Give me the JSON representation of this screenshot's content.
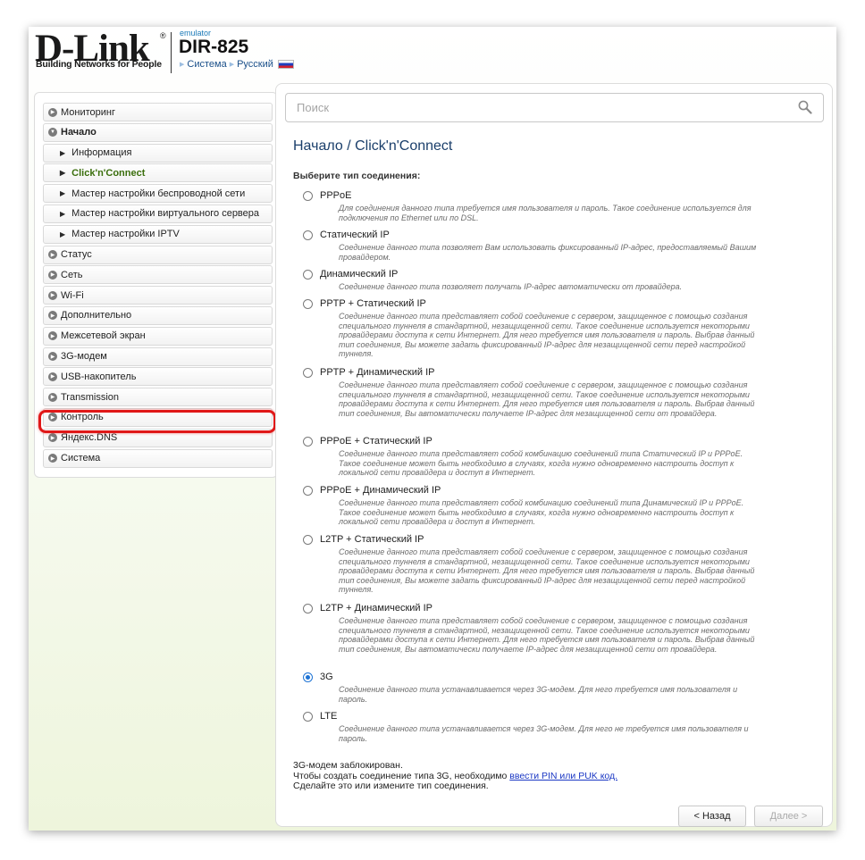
{
  "header": {
    "logo_text": "D-Link",
    "logo_registered": "®",
    "logo_tagline": "Building Networks for People",
    "emulator_label": "emulator",
    "model": "DIR-825",
    "breadcrumb": {
      "system": "Система",
      "language": "Русский"
    }
  },
  "sidebar": {
    "items": [
      {
        "label": "Мониторинг"
      },
      {
        "label": "Начало"
      },
      {
        "label": "Информация"
      },
      {
        "label": "Click'n'Connect"
      },
      {
        "label": "Мастер настройки беспроводной сети"
      },
      {
        "label": "Мастер настройки виртуального сервера"
      },
      {
        "label": "Мастер настройки IPTV"
      },
      {
        "label": "Статус"
      },
      {
        "label": "Сеть"
      },
      {
        "label": "Wi-Fi"
      },
      {
        "label": "Дополнительно"
      },
      {
        "label": "Межсетевой экран"
      },
      {
        "label": "3G-модем"
      },
      {
        "label": "USB-накопитель"
      },
      {
        "label": "Transmission"
      },
      {
        "label": "Контроль"
      },
      {
        "label": "Яндекс.DNS"
      },
      {
        "label": "Система"
      }
    ]
  },
  "search": {
    "placeholder": "Поиск"
  },
  "main": {
    "title_prefix": "Начало /",
    "title": "Click'n'Connect",
    "section_label": "Выберите тип соединения:",
    "options": [
      {
        "label": "PPPoE",
        "desc": "Для соединения данного типа требуется имя пользователя и пароль. Такое соединение используется для подключения по Ethernet или по DSL."
      },
      {
        "label": "Статический IP",
        "desc": "Соединение данного типа позволяет Вам использовать фиксированный IP-адрес, предоставляемый Вашим провайдером."
      },
      {
        "label": "Динамический IP",
        "desc": "Соединение данного типа позволяет получать IP-адрес автоматически от провайдера."
      },
      {
        "label": "PPTP + Статический IP",
        "desc": "Соединение данного типа представляет собой соединение с сервером, защищенное с помощью создания специального туннеля в стандартной, незащищенной сети. Такое соединение используется некоторыми провайдерами доступа к сети Интернет. Для него требуется имя пользователя и пароль. Выбрав данный тип соединения, Вы можете задать фиксированный IP-адрес для незащищенной сети перед настройкой туннеля."
      },
      {
        "label": "PPTP + Динамический IP",
        "desc": "Соединение данного типа представляет собой соединение с сервером, защищенное с помощью создания специального туннеля в стандартной, незащищенной сети. Такое соединение используется некоторыми провайдерами доступа к сети Интернет. Для него требуется имя пользователя и пароль. Выбрав данный тип соединения, Вы автоматически получаете IP-адрес для незащищенной сети от провайдера."
      },
      {
        "label": "PPPoE + Статический IP",
        "desc": "Соединение данного типа представляет собой комбинацию соединений типа Статический IP и PPPoE. Такое соединение может быть необходимо в случаях, когда нужно одновременно настроить доступ к локальной сети провайдера и доступ в Интернет."
      },
      {
        "label": "PPPoE + Динамический IP",
        "desc": "Соединение данного типа представляет собой комбинацию соединений типа Динамический IP и PPPoE. Такое соединение может быть необходимо в случаях, когда нужно одновременно настроить доступ к локальной сети провайдера и доступ в Интернет."
      },
      {
        "label": "L2TP + Статический IP",
        "desc": "Соединение данного типа представляет собой соединение с сервером, защищенное с помощью создания специального туннеля в стандартной, незащищенной сети. Такое соединение используется некоторыми провайдерами доступа к сети Интернет. Для него требуется имя пользователя и пароль. Выбрав данный тип соединения, Вы можете задать фиксированный IP-адрес для незащищенной сети перед настройкой туннеля."
      },
      {
        "label": "L2TP + Динамический IP",
        "desc": "Соединение данного типа представляет собой соединение с сервером, защищенное с помощью создания специального туннеля в стандартной, незащищенной сети. Такое соединение используется некоторыми провайдерами доступа к сети Интернет. Для него требуется имя пользователя и пароль. Выбрав данный тип соединения, Вы автоматически получаете IP-адрес для незащищенной сети от провайдера."
      },
      {
        "label": "3G",
        "desc": "Соединение данного типа устанавливается через 3G-модем. Для него требуется имя пользователя и пароль."
      },
      {
        "label": "LTE",
        "desc": "Соединение данного типа устанавливается через 3G-модем. Для него не требуется имя пользователя и пароль."
      }
    ],
    "status_line1": "3G-модем заблокирован.",
    "status_line2": "Чтобы создать соединение типа 3G, необходимо",
    "status_link": "ввести PIN или PUK код.",
    "status_line3": "Сделайте это или измените тип соединения.",
    "back_label": "< Назад",
    "next_label": "Далее >"
  }
}
